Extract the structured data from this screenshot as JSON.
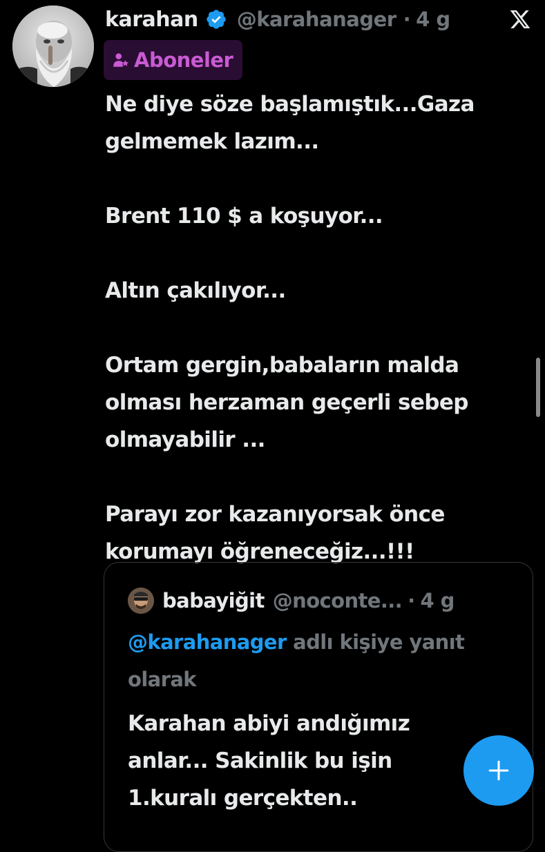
{
  "post": {
    "author": {
      "display_name": "karahan",
      "handle": "@karahanager",
      "time": "4 g",
      "verified": true
    },
    "subscribers_badge": "Aboneler",
    "paragraphs": [
      "Ne diye söze başlamıştık...Gaza gelmemek lazım...",
      "Brent 110 $ a koşuyor...",
      "Altın çakılıyor...",
      "Ortam gergin,babaların malda olması herzaman geçerli sebep olmayabilir ...",
      "Parayı zor kazanıyorsak önce korumayı öğreneceğiz...!!!"
    ]
  },
  "quote": {
    "display_name": "babayiğit",
    "handle": "@noconte...",
    "time": "4 g",
    "reply_to_mention": "@karahanager",
    "reply_to_suffix": " adlı kişiye yanıt olarak",
    "text": "Karahan abiyi andığımız anlar... Sakinlik bu işin 1.kuralı gerçekten.."
  },
  "separator": "·",
  "icons": {
    "verified": "verified-badge-icon",
    "close": "x-logo-icon",
    "subscribers": "subscriber-person-star-icon",
    "compose": "plus-icon"
  },
  "colors": {
    "background": "#000000",
    "text": "#e7e9ea",
    "muted": "#71767b",
    "accent": "#1d9bf0",
    "subscribers_badge_text": "#c95bd3",
    "subscribers_badge_bg": "#2a0d33"
  }
}
